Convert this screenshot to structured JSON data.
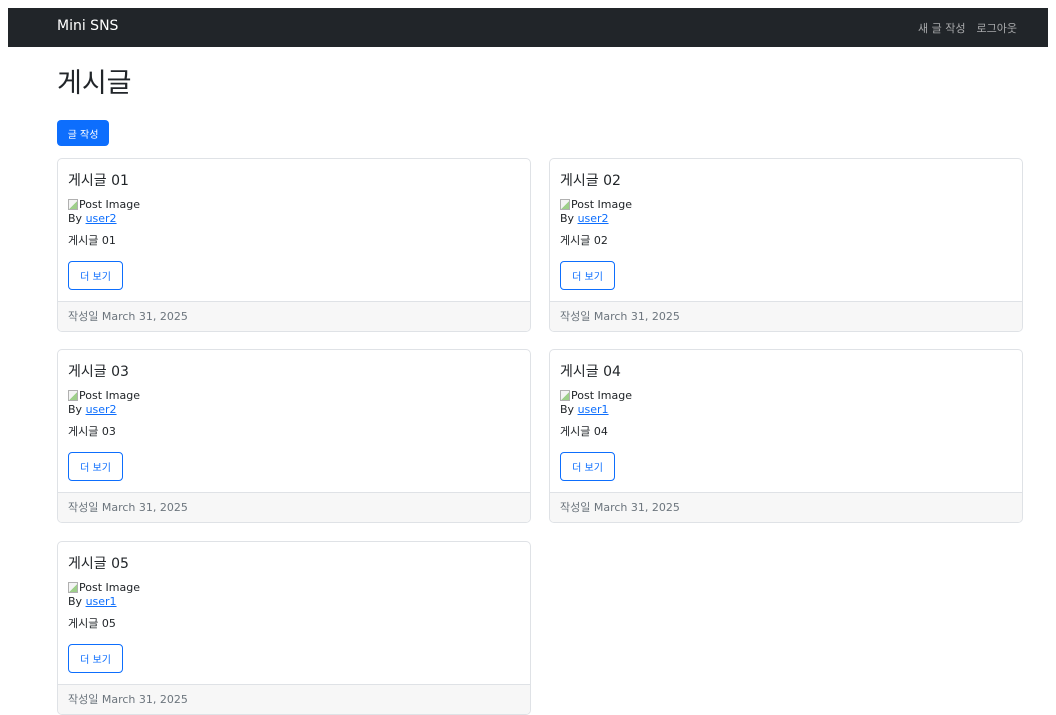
{
  "navbar": {
    "brand": "Mini SNS",
    "links": [
      "새 글 작성",
      "로그아웃"
    ]
  },
  "page": {
    "title": "게시글",
    "write_button": "글 작성"
  },
  "colors": {
    "navbar_bg": "#212529",
    "primary": "#0d6efd",
    "footer_bg": "#f7f7f7",
    "muted_text": "#6c757d"
  },
  "posts": [
    {
      "title": "게시글 01",
      "image_alt": "Post Image",
      "by_label": "By",
      "author": "user2",
      "content": "게시글 01",
      "more_button": "더 보기",
      "footer": "작성일 March 31, 2025"
    },
    {
      "title": "게시글 02",
      "image_alt": "Post Image",
      "by_label": "By",
      "author": "user2",
      "content": "게시글 02",
      "more_button": "더 보기",
      "footer": "작성일 March 31, 2025"
    },
    {
      "title": "게시글 03",
      "image_alt": "Post Image",
      "by_label": "By",
      "author": "user2",
      "content": "게시글 03",
      "more_button": "더 보기",
      "footer": "작성일 March 31, 2025"
    },
    {
      "title": "게시글 04",
      "image_alt": "Post Image",
      "by_label": "By",
      "author": "user1",
      "content": "게시글 04",
      "more_button": "더 보기",
      "footer": "작성일 March 31, 2025"
    },
    {
      "title": "게시글 05",
      "image_alt": "Post Image",
      "by_label": "By",
      "author": "user1",
      "content": "게시글 05",
      "more_button": "더 보기",
      "footer": "작성일 March 31, 2025"
    }
  ]
}
